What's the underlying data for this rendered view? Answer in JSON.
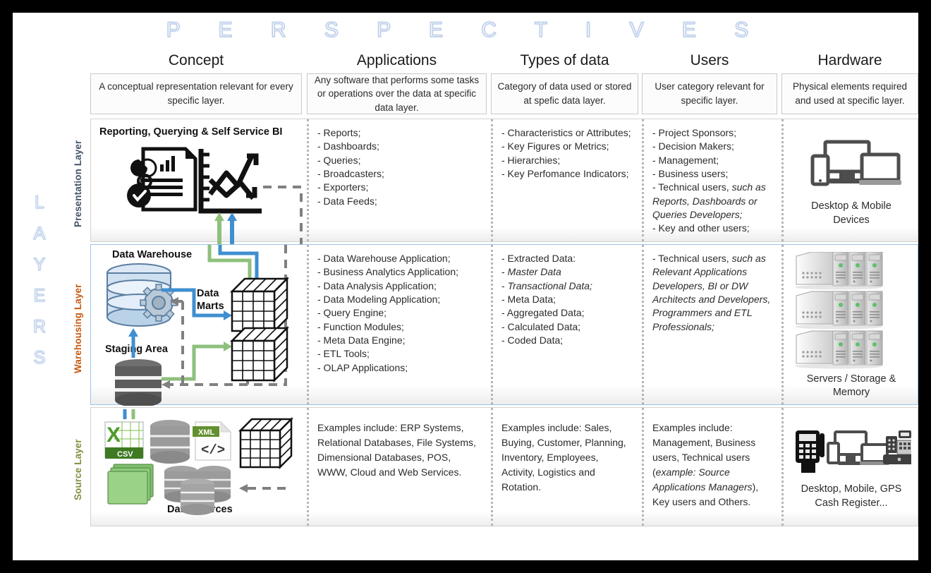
{
  "title": "P E R S P E C T I V E S",
  "axis_label": "LAYERS",
  "columns": [
    {
      "id": "concept",
      "header": "Concept",
      "desc": "A conceptual representation\nrelevant for every specific layer."
    },
    {
      "id": "apps",
      "header": "Applications",
      "desc": "Any software that performs  some\ntasks or operations over the data\nat specific data layer."
    },
    {
      "id": "types",
      "header": "Types of data",
      "desc": "Category of data used or\nstored at spefic data layer."
    },
    {
      "id": "users",
      "header": "Users",
      "desc": "User category relevant for\nspecific layer."
    },
    {
      "id": "hardware",
      "header": "Hardware",
      "desc": "Physical elements\nrequired and used at\nspecific layer."
    }
  ],
  "layers": [
    {
      "id": "presentation",
      "label": "Presentation Layer",
      "label_color": "#44546a",
      "concept_title": "Reporting, Querying & Self Service BI",
      "applications": "- Reports;\n- Dashboards;\n- Queries;\n- Broadcasters;\n- Exporters;\n- Data Feeds;",
      "types_of_data": "- Characteristics or Attributes;\n- Key Figures or Metrics;\n- Hierarchies;\n- Key Perfomance Indicators;",
      "users_plain_1": "- Project Sponsors;\n- Decision Makers;\n- Management;\n- Business users;\n- Technical users, ",
      "users_italic": "such as Reports, Dashboards or Queries Developers;",
      "users_plain_2": "\n- Key and other  users;",
      "hardware_caption": "Desktop\n& Mobile Devices",
      "hardware_icon": "desktop-and-mobile-devices-icon"
    },
    {
      "id": "warehousing",
      "label": "Warehousing Layer",
      "label_color": "#c55a11",
      "concept_nodes": [
        {
          "name": "Data Warehouse"
        },
        {
          "name": "Data\nMarts"
        },
        {
          "name": "Staging Area"
        }
      ],
      "applications": "- Data Warehouse Application;\n- Business Analytics Application;\n- Data Analysis Application;\n- Data Modeling Application;\n- Query Engine;\n- Function Modules;\n- Meta Data Engine;\n- ETL Tools;\n- OLAP Applications;",
      "types_plain_1": "- Extracted Data:\n    - ",
      "types_italic_1": "Master Data",
      "types_plain_2": "\n      - ",
      "types_italic_2": "Transactional Data;",
      "types_plain_3": "\n- Meta Data;\n- Aggregated Data;\n- Calculated Data;\n- Coded Data;",
      "users_plain_1": "- Technical users, ",
      "users_italic": "such as Relevant Applications Developers, BI or DW Architects and Developers, Programmers and ETL Professionals;",
      "hardware_caption": "Servers /\nStorage & Memory",
      "hardware_icon": "server-racks-icon"
    },
    {
      "id": "source",
      "label": "Source Layer",
      "label_color": "#7f8f3f",
      "concept_title": "Data Sources",
      "applications": "Examples include: ERP Systems, Relational Databases, File Systems, Dimensional Databases, POS, WWW, Cloud and Web Services.",
      "types_of_data": "Examples include: Sales, Buying, Customer, Planning, Inventory, Employees, Activity, Logistics and Rotation.",
      "users_plain_1": "Examples include: Management, Business users, Technical users (",
      "users_italic": "example: Source Applications Managers",
      "users_plain_2": "), Key users and Others.",
      "hardware_caption": "Desktop, Mobile, GPS\nCash Register...",
      "hardware_icon": "pos-desktop-cashregister-icon"
    }
  ],
  "source_icons": [
    {
      "name": "csv-file-icon",
      "label": "CSV"
    },
    {
      "name": "database-cylinder-icon",
      "label": ""
    },
    {
      "name": "xml-file-icon",
      "label": "XML"
    },
    {
      "name": "olap-cube-icon",
      "label": ""
    },
    {
      "name": "flat-files-icon",
      "label": ""
    },
    {
      "name": "database-cluster-icon",
      "label": ""
    }
  ],
  "colors": {
    "title_outline": "#b9cbe8",
    "presentation_label": "#44546a",
    "warehousing_label": "#c55a11",
    "source_label": "#7f8f3f",
    "warehouse_row_border": "#9dc3e6",
    "flow_blue": "#2e75b6",
    "flow_green": "#8ec07c",
    "flow_dashed": "#808080",
    "frame": "#000000"
  }
}
